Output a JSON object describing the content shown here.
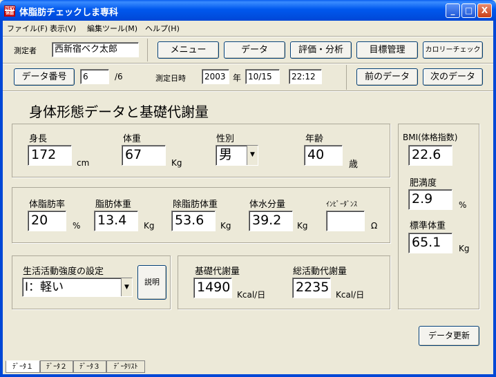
{
  "window": {
    "title": "体脂肪チェックしま専科",
    "icon_label_top": "NEW",
    "icon_label_bottom": "体脂"
  },
  "titlebar_buttons": {
    "minimize": "_",
    "maximize": "□",
    "close": "X"
  },
  "menu": [
    "ファイル(F)",
    "表示(V)",
    "編集ツール(M)",
    "ヘルプ(H)"
  ],
  "toolbar": {
    "person_label": "測定者",
    "person_value": "西新宿ベク太郎",
    "buttons": [
      "メニュー",
      "データ",
      "評価・分析",
      "目標管理",
      "カロリーチェック"
    ]
  },
  "record": {
    "data_number_button": "データ番号",
    "current": "6",
    "total": "/6",
    "date_label": "測定日時",
    "year": "2003",
    "year_unit": "年",
    "date": "10/15",
    "time": "22:12",
    "prev_button": "前のデータ",
    "next_button": "次のデータ"
  },
  "heading": "身体形態データと基礎代謝量",
  "body": {
    "height_label": "身長",
    "height": "172",
    "height_unit": "cm",
    "weight_label": "体重",
    "weight": "67",
    "weight_unit": "Kg",
    "sex_label": "性別",
    "sex": "男",
    "sex_arrow": "▼",
    "age_label": "年齢",
    "age": "40",
    "age_unit": "歳"
  },
  "composition": {
    "fat_rate_label": "体脂肪率",
    "fat_rate": "20",
    "fat_rate_unit": "%",
    "fat_mass_label": "脂肪体重",
    "fat_mass": "13.4",
    "fat_mass_unit": "Kg",
    "lean_mass_label": "除脂肪体重",
    "lean_mass": "53.6",
    "lean_mass_unit": "Kg",
    "water_label": "体水分量",
    "water": "39.2",
    "water_unit": "Kg",
    "impedance_label": "ｲﾝﾋﾟｰﾀﾞﾝｽ",
    "impedance": "",
    "impedance_unit": "Ω"
  },
  "activity": {
    "label": "生活活動強度の設定",
    "value": "Ⅰ：軽い",
    "arrow": "▼",
    "explain_button": "説明"
  },
  "metabolism": {
    "basal_label": "基礎代謝量",
    "basal": "1490",
    "basal_unit": "Kcal/日",
    "total_label": "総活動代謝量",
    "total": "2235",
    "total_unit": "Kcal/日"
  },
  "bmi": {
    "bmi_label": "BMI(体格指数)",
    "bmi": "22.6",
    "obesity_label": "肥満度",
    "obesity": "2.9",
    "obesity_unit": "%",
    "std_weight_label": "標準体重",
    "std_weight": "65.1",
    "std_weight_unit": "Kg"
  },
  "update_button": "データ更新",
  "tabs": [
    "ﾃﾞｰﾀ１",
    "ﾃﾞｰﾀ２",
    "ﾃﾞｰﾀ３",
    "ﾃﾞｰﾀﾘｽﾄ"
  ]
}
